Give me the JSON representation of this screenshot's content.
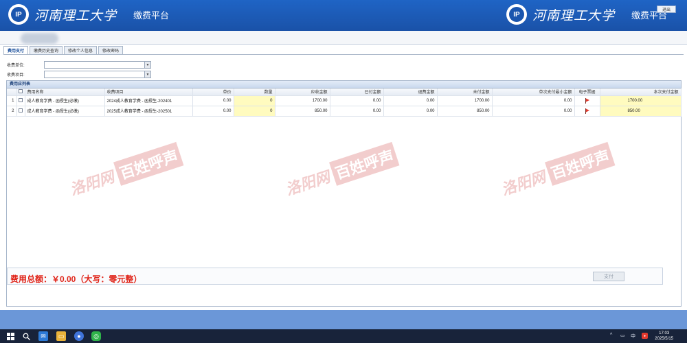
{
  "header": {
    "university_name": "河南理工大学",
    "platform_title": "缴费平台",
    "exit_label": "退出",
    "seal_text": "IP"
  },
  "tabs": [
    {
      "label": "费用支付",
      "active": true
    },
    {
      "label": "缴费历史查询",
      "active": false
    },
    {
      "label": "修改个人信息",
      "active": false
    },
    {
      "label": "修改密码",
      "active": false
    }
  ],
  "filters": {
    "unit_label": "收费单位:",
    "unit_value": "",
    "item_label": "收费项目:",
    "item_value": ""
  },
  "grid": {
    "panel_title": "费用应列表",
    "columns": [
      "",
      "",
      "费用名称",
      "收费项目",
      "单价",
      "数量",
      "应收金额",
      "已付金额",
      "退费金额",
      "未付金额",
      "单次支付最小金额",
      "电子票据",
      "本次支付金额"
    ],
    "rows": [
      {
        "index": "1",
        "name": "成人教育学费 - 函授生(必缴)",
        "item": "2024成人教育学费 - 函授生-202401",
        "unit_price": "0.00",
        "qty": "0",
        "receivable": "1700.00",
        "paid": "0.00",
        "refund": "0.00",
        "unpaid": "1700.00",
        "min_pay": "0.00",
        "pay_now": "1700.00"
      },
      {
        "index": "2",
        "name": "成人教育学费 - 函授生(必缴)",
        "item": "2025成人教育学费 - 函授生-202501",
        "unit_price": "0.00",
        "qty": "0",
        "receivable": "850.00",
        "paid": "0.00",
        "refund": "0.00",
        "unpaid": "850.00",
        "min_pay": "0.00",
        "pay_now": "850.00"
      }
    ]
  },
  "footer": {
    "total_text": "费用总额：￥0.00（大写：零元整）",
    "pay_label": "支付"
  },
  "watermark": {
    "script_text": "洛阳网",
    "box_text": "百姓呼声"
  },
  "taskbar": {
    "time": "17:03",
    "date": "2025/5/15",
    "lang": "中"
  },
  "colors": {
    "header_blue": "#1f64c5",
    "highlight_yellow": "#fffbbf",
    "total_red": "#e0261b"
  }
}
